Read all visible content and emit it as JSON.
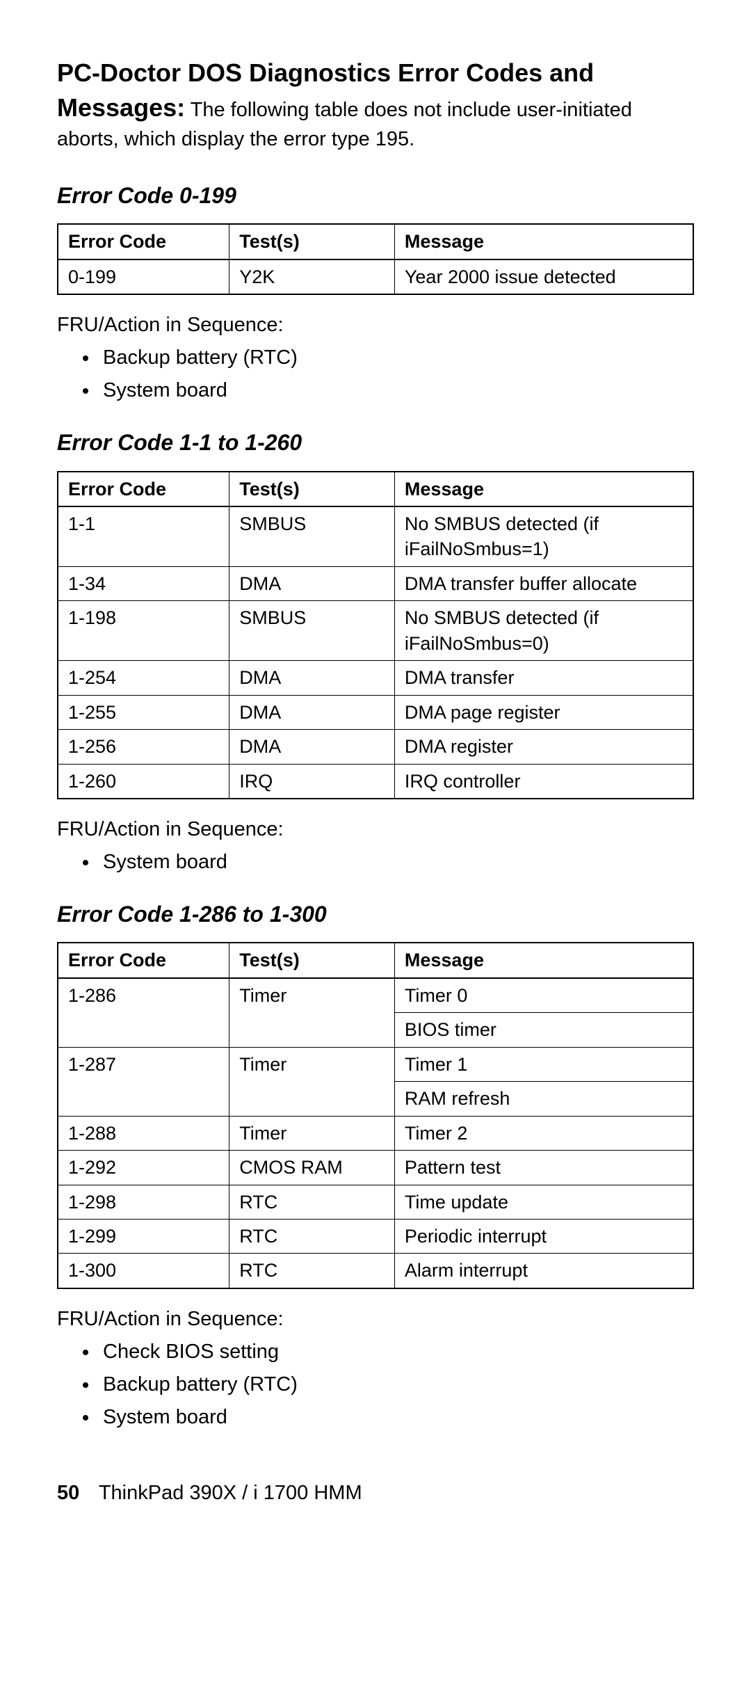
{
  "title": "PC-Doctor DOS Diagnostics Error Codes and Messages:",
  "intro_text": "The following table does not include user-initiated aborts, which display the error type 195.",
  "fru_label": "FRU/Action in Sequence:",
  "headers": {
    "code": "Error Code",
    "tests": "Test(s)",
    "message": "Message"
  },
  "section1": {
    "heading": "Error Code 0-199",
    "rows": [
      {
        "code": "0-199",
        "tests": "Y2K",
        "message": "Year 2000 issue detected"
      }
    ],
    "actions": [
      "Backup battery (RTC)",
      "System board"
    ]
  },
  "section2": {
    "heading": "Error Code 1-1 to 1-260",
    "rows": [
      {
        "code": "1-1",
        "tests": "SMBUS",
        "message": "No SMBUS detected (if iFailNoSmbus=1)"
      },
      {
        "code": "1-34",
        "tests": "DMA",
        "message": "DMA transfer buffer allocate"
      },
      {
        "code": "1-198",
        "tests": "SMBUS",
        "message": "No SMBUS detected (if iFailNoSmbus=0)"
      },
      {
        "code": "1-254",
        "tests": "DMA",
        "message": "DMA transfer"
      },
      {
        "code": "1-255",
        "tests": "DMA",
        "message": "DMA page register"
      },
      {
        "code": "1-256",
        "tests": "DMA",
        "message": "DMA register"
      },
      {
        "code": "1-260",
        "tests": "IRQ",
        "message": "IRQ controller"
      }
    ],
    "actions": [
      "System board"
    ]
  },
  "section3": {
    "heading": "Error Code 1-286 to 1-300",
    "rows": [
      {
        "code": "1-286",
        "tests": "Timer",
        "msg1": "Timer 0",
        "msg2": "BIOS timer"
      },
      {
        "code": "1-287",
        "tests": "Timer",
        "msg1": "Timer 1",
        "msg2": "RAM refresh"
      },
      {
        "code": "1-288",
        "tests": "Timer",
        "message": "Timer 2"
      },
      {
        "code": "1-292",
        "tests": "CMOS RAM",
        "message": "Pattern test"
      },
      {
        "code": "1-298",
        "tests": "RTC",
        "message": "Time update"
      },
      {
        "code": "1-299",
        "tests": "RTC",
        "message": "Periodic interrupt"
      },
      {
        "code": "1-300",
        "tests": "RTC",
        "message": "Alarm interrupt"
      }
    ],
    "actions": [
      "Check BIOS setting",
      "Backup battery (RTC)",
      "System board"
    ]
  },
  "footer": {
    "page": "50",
    "title": "ThinkPad 390X / i 1700 HMM"
  }
}
